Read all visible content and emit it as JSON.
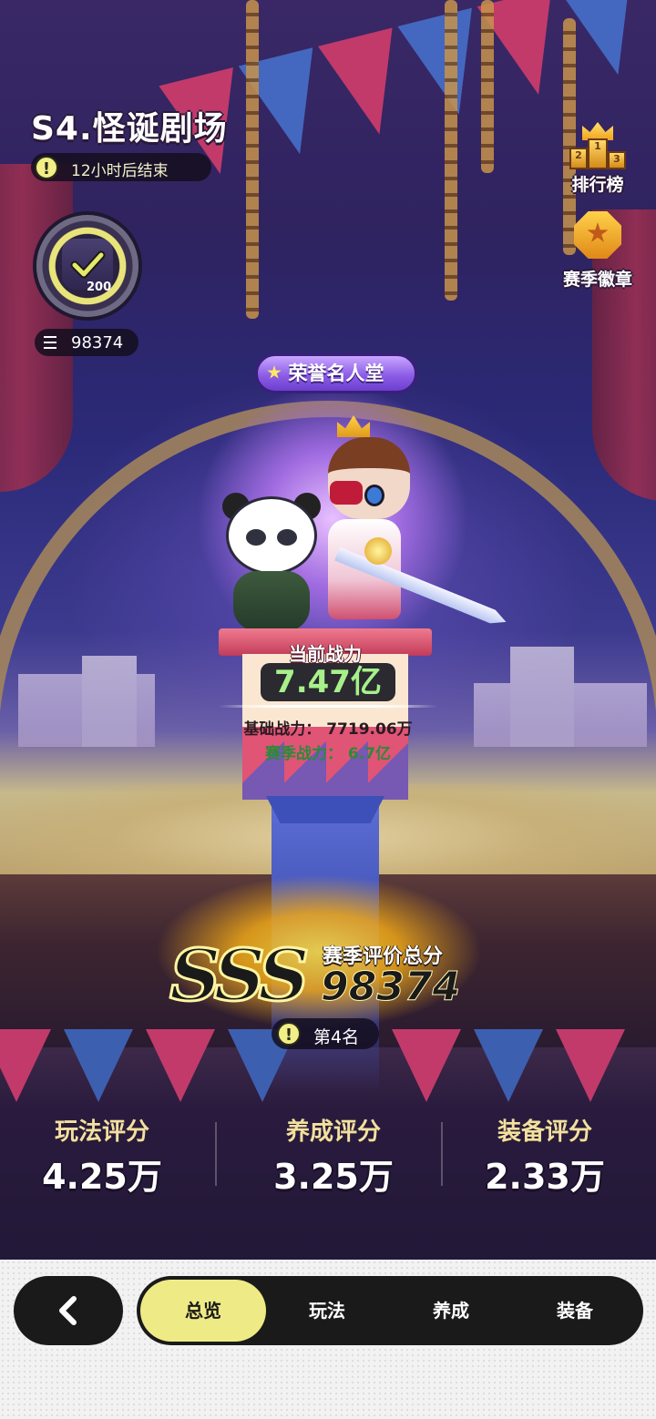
{
  "season": {
    "title": "S4.怪诞剧场",
    "timer": "12小时后结束",
    "info_glyph": "!"
  },
  "badge": {
    "level": "200",
    "score": "98374",
    "icon": "check-badge-icon"
  },
  "side_buttons": {
    "ranking": {
      "label": "排行榜",
      "icon": "podium-crown-icon",
      "podium": [
        "2",
        "1",
        "3"
      ]
    },
    "season_badge": {
      "label": "赛季徽章",
      "icon": "medal-icon"
    }
  },
  "hall_of_fame": {
    "label": "荣誉名人堂"
  },
  "power": {
    "label": "当前战力",
    "value": "7.47亿",
    "base": "基础战力： 7719.06万",
    "season": "赛季战力： 6.7亿"
  },
  "rating": {
    "grade": "SSS",
    "total_label": "赛季评价总分",
    "total_value": "98374",
    "rank": "第4名"
  },
  "scores": [
    {
      "label": "玩法评分",
      "value": "4.25万"
    },
    {
      "label": "养成评分",
      "value": "3.25万"
    },
    {
      "label": "装备评分",
      "value": "2.33万"
    }
  ],
  "nav": {
    "back_icon": "chevron-left-icon",
    "tabs": [
      "总览",
      "玩法",
      "养成",
      "装备"
    ],
    "active_tab": "总览"
  },
  "colors": {
    "accent_yellow": "#eeeb86",
    "power_green": "#a8f08a",
    "season_power_green": "#2c8a3a",
    "tab_bar_bg": "#1a1a1a"
  }
}
